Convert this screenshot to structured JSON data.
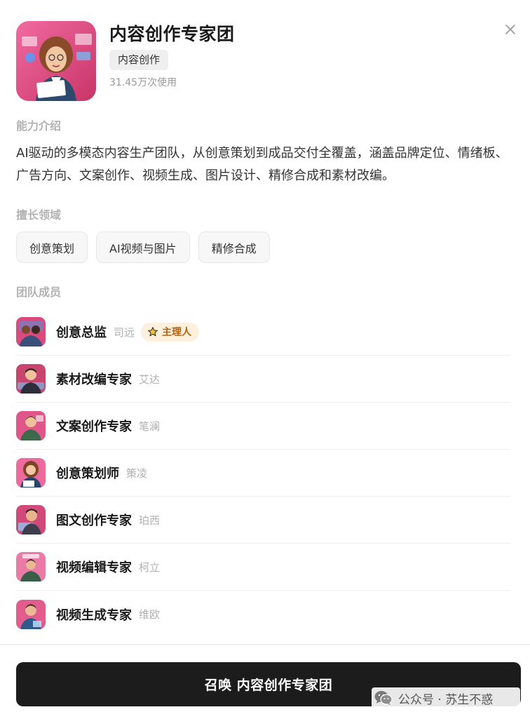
{
  "app": {
    "title": "内容创作专家团",
    "tag": "内容创作",
    "usage": "31.45万次使用"
  },
  "sections": {
    "intro_label": "能力介绍",
    "description": "AI驱动的多模态内容生产团队，从创意策划到成品交付全覆盖，涵盖品牌定位、情绪板、广告方向、文案创作、视频生成、图片设计、精修合成和素材改编。",
    "expertise_label": "擅长领域",
    "team_label": "团队成员"
  },
  "expertise": [
    {
      "label": "创意策划"
    },
    {
      "label": "AI视频与图片"
    },
    {
      "label": "精修合成"
    }
  ],
  "members": [
    {
      "name": "创意总监",
      "alias": "司远",
      "badge": "主理人"
    },
    {
      "name": "素材改编专家",
      "alias": "艾达"
    },
    {
      "name": "文案创作专家",
      "alias": "笔澜"
    },
    {
      "name": "创意策划师",
      "alias": "策凌"
    },
    {
      "name": "图文创作专家",
      "alias": "珀西"
    },
    {
      "name": "视频编辑专家",
      "alias": "柯立"
    },
    {
      "name": "视频生成专家",
      "alias": "维欧"
    }
  ],
  "cta": {
    "label": "召唤 内容创作专家团"
  },
  "watermark": {
    "text": "公众号 · 苏生不惑"
  },
  "colors": {
    "accent_dark": "#1c1c1c",
    "badge_bg": "#fdf0dc",
    "badge_text": "#b5620a",
    "avatar_pink": "#e0457a"
  },
  "icons": {
    "close": "close-icon",
    "lead": "star-icon",
    "watermark": "wechat-icon"
  }
}
